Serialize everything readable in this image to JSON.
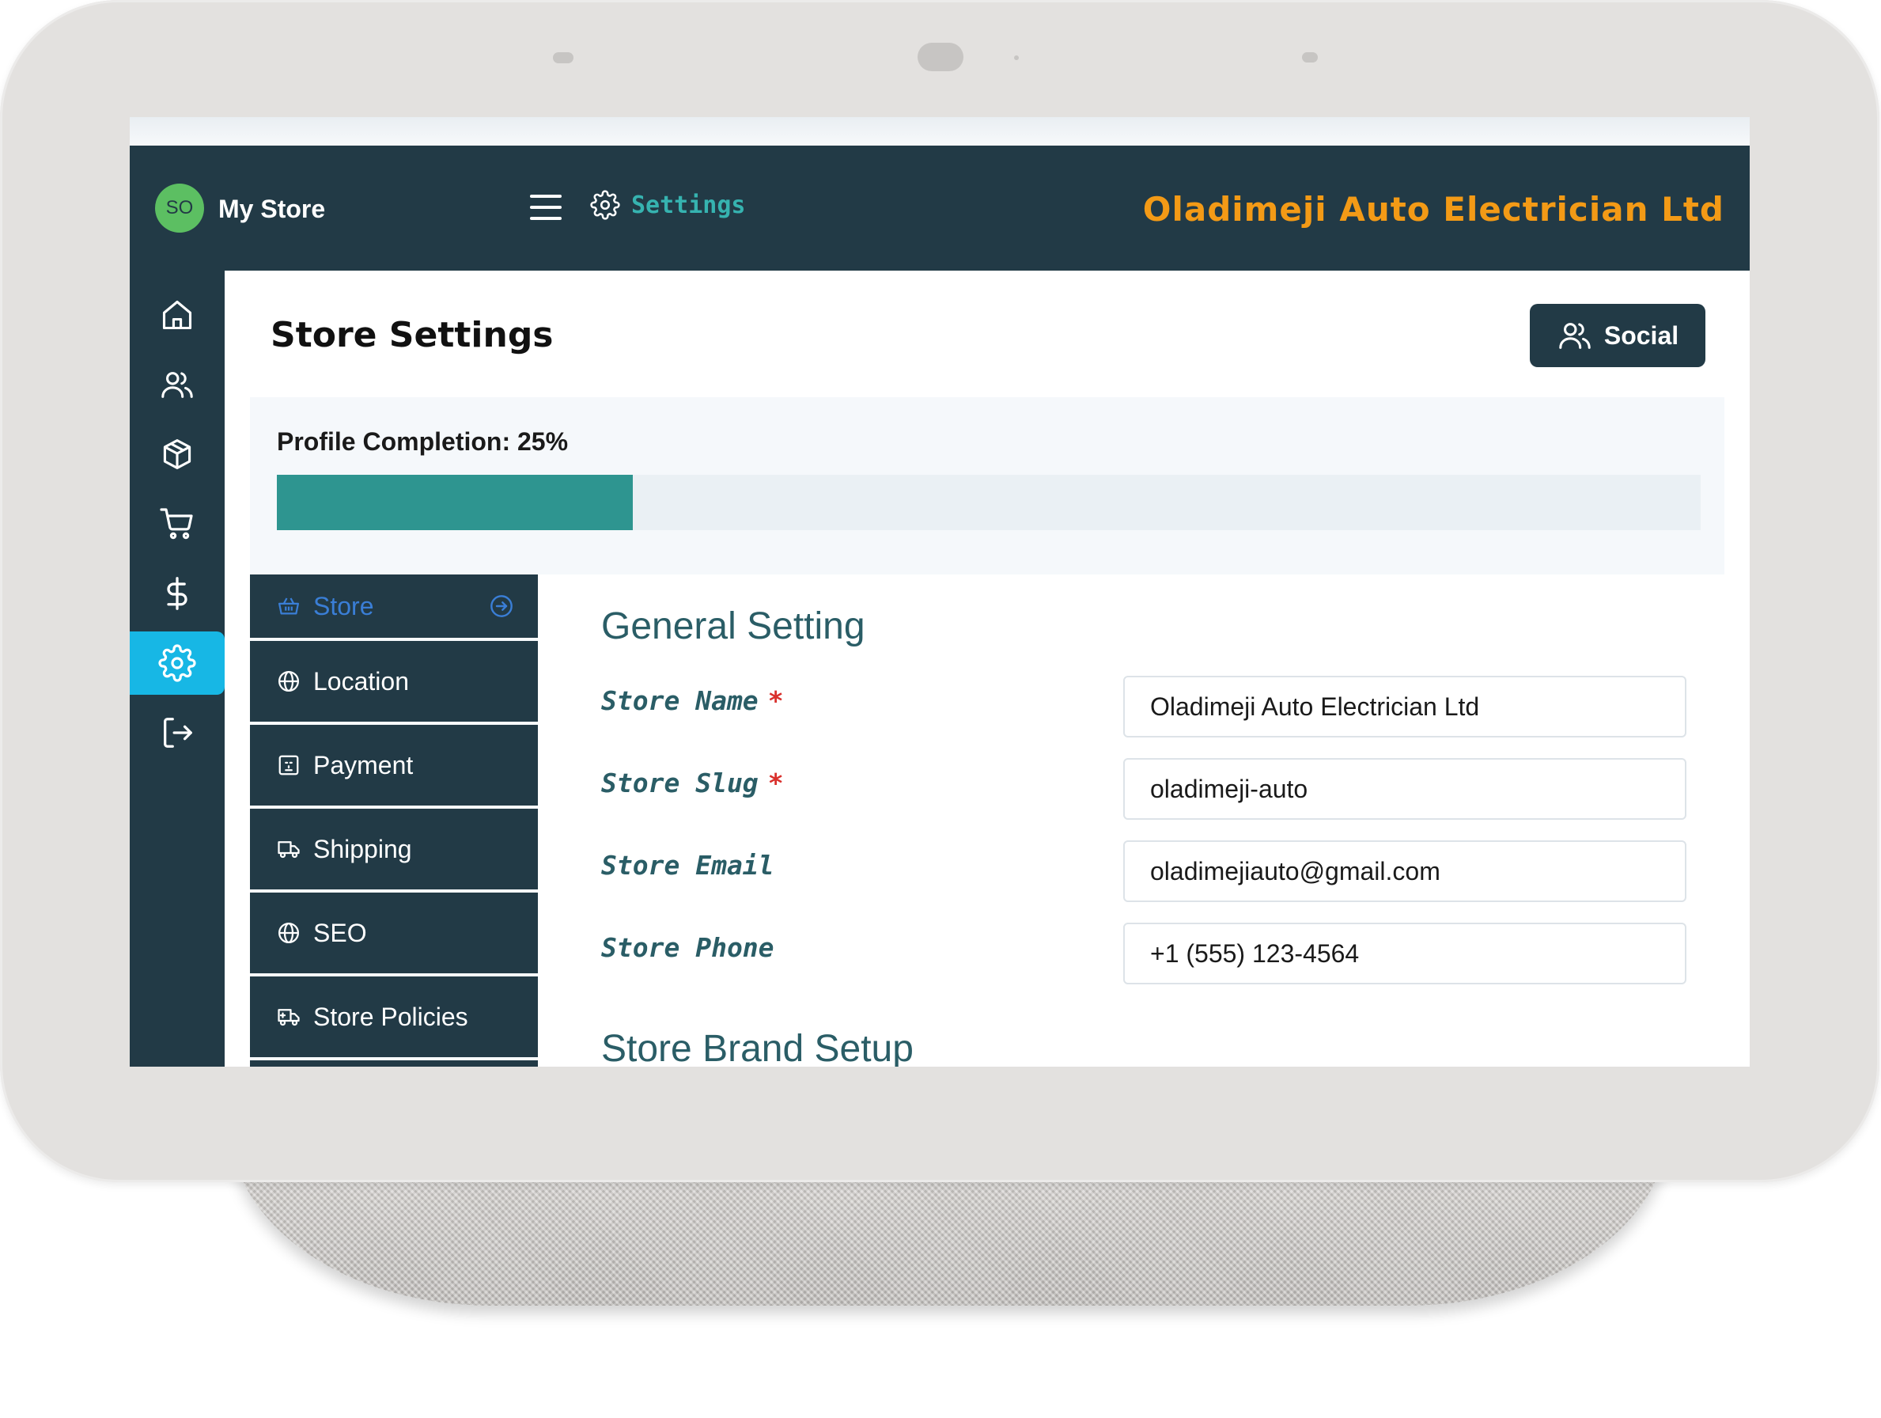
{
  "header": {
    "avatar_initials": "SO",
    "store_name": "My Store",
    "menu_icon": "hamburger-icon",
    "settings_label": "Settings",
    "company_name": "Oladimeji Auto Electrician Ltd"
  },
  "rail": {
    "items": [
      {
        "icon": "home-icon",
        "active": false
      },
      {
        "icon": "users-icon",
        "active": false
      },
      {
        "icon": "box-icon",
        "active": false
      },
      {
        "icon": "cart-icon",
        "active": false
      },
      {
        "icon": "dollar-icon",
        "active": false
      },
      {
        "icon": "gear-icon",
        "active": true
      },
      {
        "icon": "logout-icon",
        "active": false
      }
    ]
  },
  "page": {
    "title": "Store Settings",
    "social_button": "Social"
  },
  "progress": {
    "label": "Profile Completion: 25%",
    "percent": 25
  },
  "tabs": [
    {
      "label": "Store",
      "icon": "basket-icon",
      "active": true
    },
    {
      "label": "Location",
      "icon": "globe-icon",
      "active": false
    },
    {
      "label": "Payment",
      "icon": "payment-icon",
      "active": false
    },
    {
      "label": "Shipping",
      "icon": "truck-icon",
      "active": false
    },
    {
      "label": "SEO",
      "icon": "globe-icon",
      "active": false
    },
    {
      "label": "Store Policies",
      "icon": "truck-icon",
      "active": false
    }
  ],
  "form": {
    "section_title": "General Setting",
    "next_section_title": "Store Brand Setup",
    "fields": [
      {
        "label": "Store Name",
        "required": true,
        "value": "Oladimeji Auto Electrician Ltd"
      },
      {
        "label": "Store Slug",
        "required": true,
        "value": "oladimeji-auto"
      },
      {
        "label": "Store Email",
        "required": false,
        "value": "oladimejiauto@gmail.com"
      },
      {
        "label": "Store Phone",
        "required": false,
        "value": "+1 (555) 123-4564"
      }
    ],
    "required_marker": "*"
  },
  "colors": {
    "header_bg": "#223a46",
    "accent_teal": "#2e9590",
    "settings_teal": "#36b3b0",
    "company_orange": "#f39a16",
    "active_rail": "#17b7e5",
    "required_red": "#d9302c"
  }
}
